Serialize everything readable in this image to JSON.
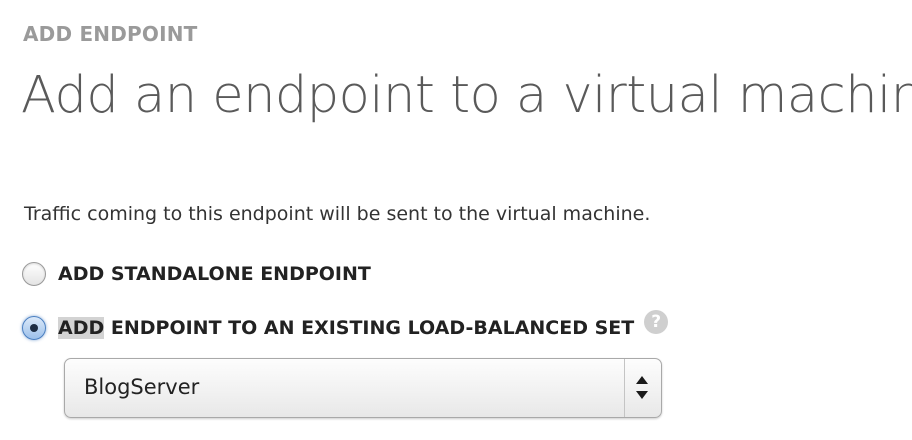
{
  "step_label": "ADD ENDPOINT",
  "title": "Add an endpoint to a virtual machine",
  "description": "Traffic coming to this endpoint will be sent to the virtual machine.",
  "options": {
    "standalone": {
      "label": "ADD STANDALONE ENDPOINT",
      "selected": false
    },
    "existing": {
      "label_highlight": "ADD",
      "label_rest": " ENDPOINT TO AN EXISTING LOAD-BALANCED SET",
      "selected": true,
      "help_icon": "question-mark-circle",
      "help_glyph": "?"
    }
  },
  "load_balanced_set": {
    "selected_value": "BlogServer",
    "arrows_icon": "up-down-chevrons"
  },
  "colors": {
    "step_label": "#9a9a9a",
    "title": "#5a5a5a",
    "radio_selected": "#4a7fc1",
    "help_icon": "#cfcfcf",
    "label_highlight": "#d3d3d3"
  }
}
